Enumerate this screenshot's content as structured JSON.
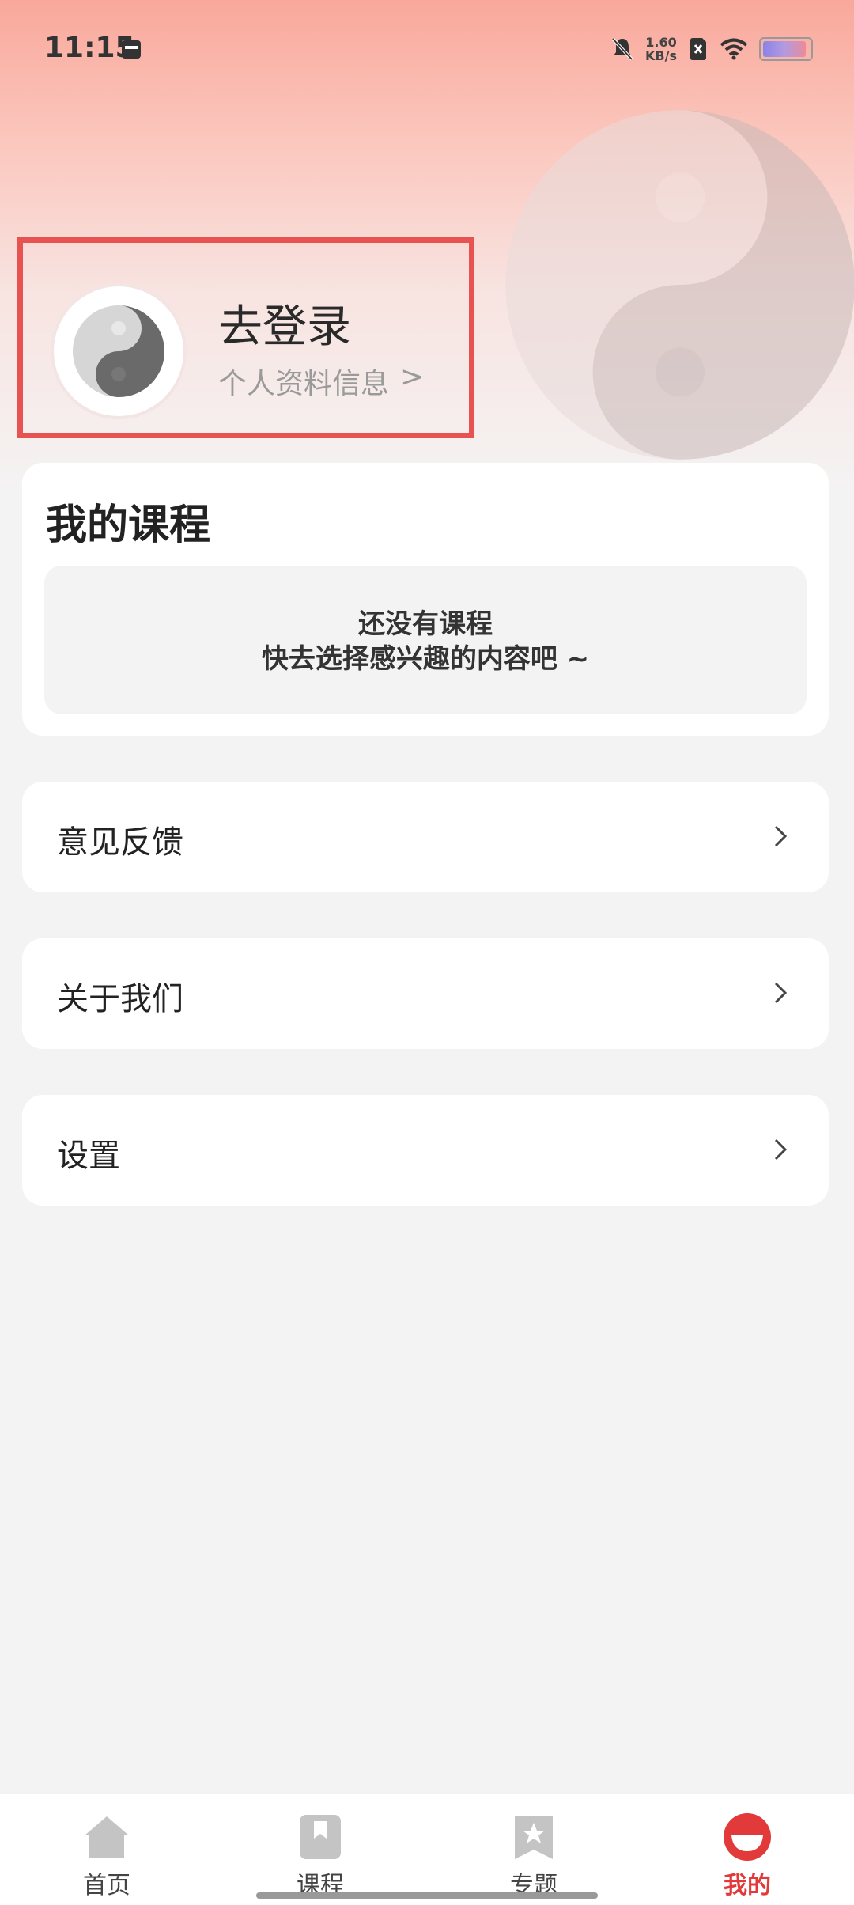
{
  "status_bar": {
    "time": "11:15",
    "net_speed_value": "1.60",
    "net_speed_unit": "KB/s",
    "icons": [
      "calendar-icon",
      "mute-bell-icon",
      "sim-error-icon",
      "wifi-icon",
      "battery-icon"
    ]
  },
  "profile": {
    "login_label": "去登录",
    "subtitle": "个人资料信息",
    "subtitle_arrow": ">"
  },
  "courses": {
    "title": "我的课程",
    "empty_line1": "还没有课程",
    "empty_line2": "快去选择感兴趣的内容吧 ~"
  },
  "menu": [
    {
      "label": "意见反馈"
    },
    {
      "label": "关于我们"
    },
    {
      "label": "设置"
    }
  ],
  "bottom_nav": [
    {
      "label": "首页",
      "icon": "home-icon"
    },
    {
      "label": "课程",
      "icon": "bookmark-icon"
    },
    {
      "label": "专题",
      "icon": "star-badge-icon"
    },
    {
      "label": "我的",
      "icon": "profile-icon",
      "active": true
    }
  ],
  "colors": {
    "accent": "#e23a3a",
    "highlight_border": "#e85352",
    "header_gradient_top": "#f9a89b"
  }
}
